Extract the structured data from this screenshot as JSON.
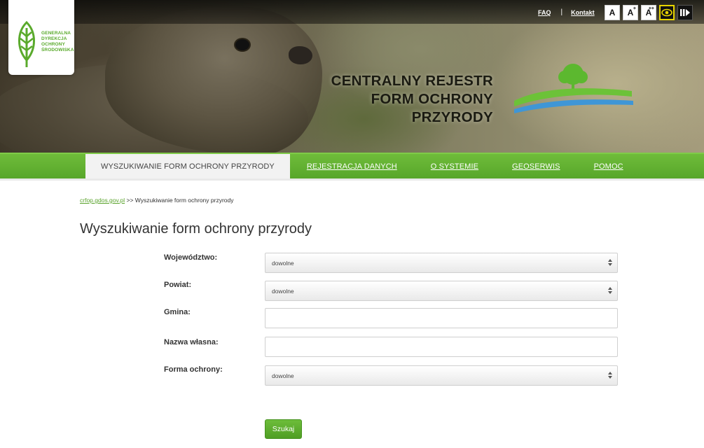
{
  "header": {
    "logo_lines": [
      "GENERALNA",
      "DYREKCJA",
      "OCHRONY",
      "ŚRODOWISKA"
    ],
    "title_line1": "CENTRALNY REJESTR",
    "title_line2": "FORM OCHRONY PRZYRODY",
    "links": {
      "faq": "FAQ",
      "kontakt": "Kontakt"
    },
    "accessibility": {
      "font_normal": "A",
      "font_larger": "A",
      "font_larger_sup": "+",
      "font_largest": "A",
      "font_largest_sup": "++"
    }
  },
  "nav": {
    "items": [
      {
        "label": "WYSZUKIWANIE FORM OCHRONY PRZYRODY",
        "active": true
      },
      {
        "label": "REJESTRACJA DANYCH"
      },
      {
        "label": "O SYSTEMIE"
      },
      {
        "label": "GEOSERWIS"
      },
      {
        "label": "POMOC"
      }
    ]
  },
  "breadcrumb": {
    "home": "crfop.gdos.gov.pl",
    "separator": ">>",
    "current": "Wyszukiwanie form ochrony przyrody"
  },
  "page": {
    "title": "Wyszukiwanie form ochrony przyrody"
  },
  "form": {
    "wojewodztwo": {
      "label": "Województwo:",
      "value": "dowolne"
    },
    "powiat": {
      "label": "Powiat:",
      "value": "dowolne"
    },
    "gmina": {
      "label": "Gmina:",
      "value": ""
    },
    "nazwa": {
      "label": "Nazwa własna:",
      "value": ""
    },
    "forma": {
      "label": "Forma ochrony:",
      "value": "dowolne"
    },
    "submit": "Szukaj"
  },
  "colors": {
    "accent": "#5aa32c",
    "nav": "#5eae2e",
    "title_logo_blue": "#3f96d6"
  }
}
